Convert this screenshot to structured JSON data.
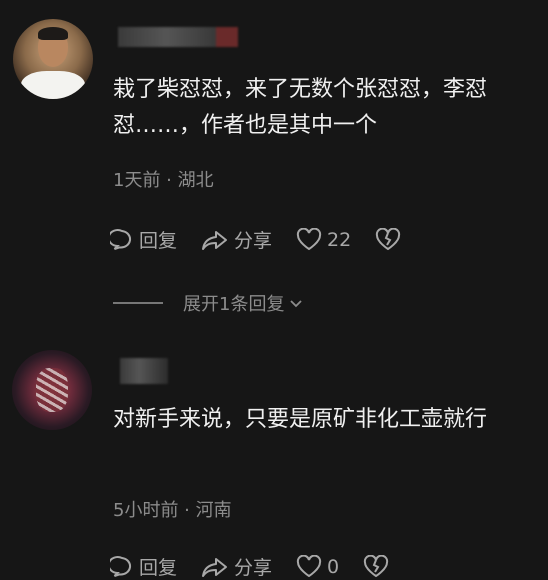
{
  "comments": [
    {
      "text": "栽了柴怼怼，来了无数个张怼怼，李怼怼……，作者也是其中一个",
      "meta": "1天前 · 湖北",
      "reply_label": "回复",
      "share_label": "分享",
      "like_count": "22",
      "expand_replies": "展开1条回复"
    },
    {
      "text": "对新手来说，只要是原矿非化工壶就行",
      "meta": "5小时前 · 河南",
      "reply_label": "回复",
      "share_label": "分享",
      "like_count": "0"
    }
  ],
  "icons": [
    "comment-icon",
    "share-icon",
    "heart-icon",
    "broken-heart-icon",
    "chevron-down-icon"
  ],
  "colors": {
    "background": "#161616",
    "text": "#f0f0f0",
    "meta": "#8c8c8c",
    "actions": "#a8a8a8"
  }
}
